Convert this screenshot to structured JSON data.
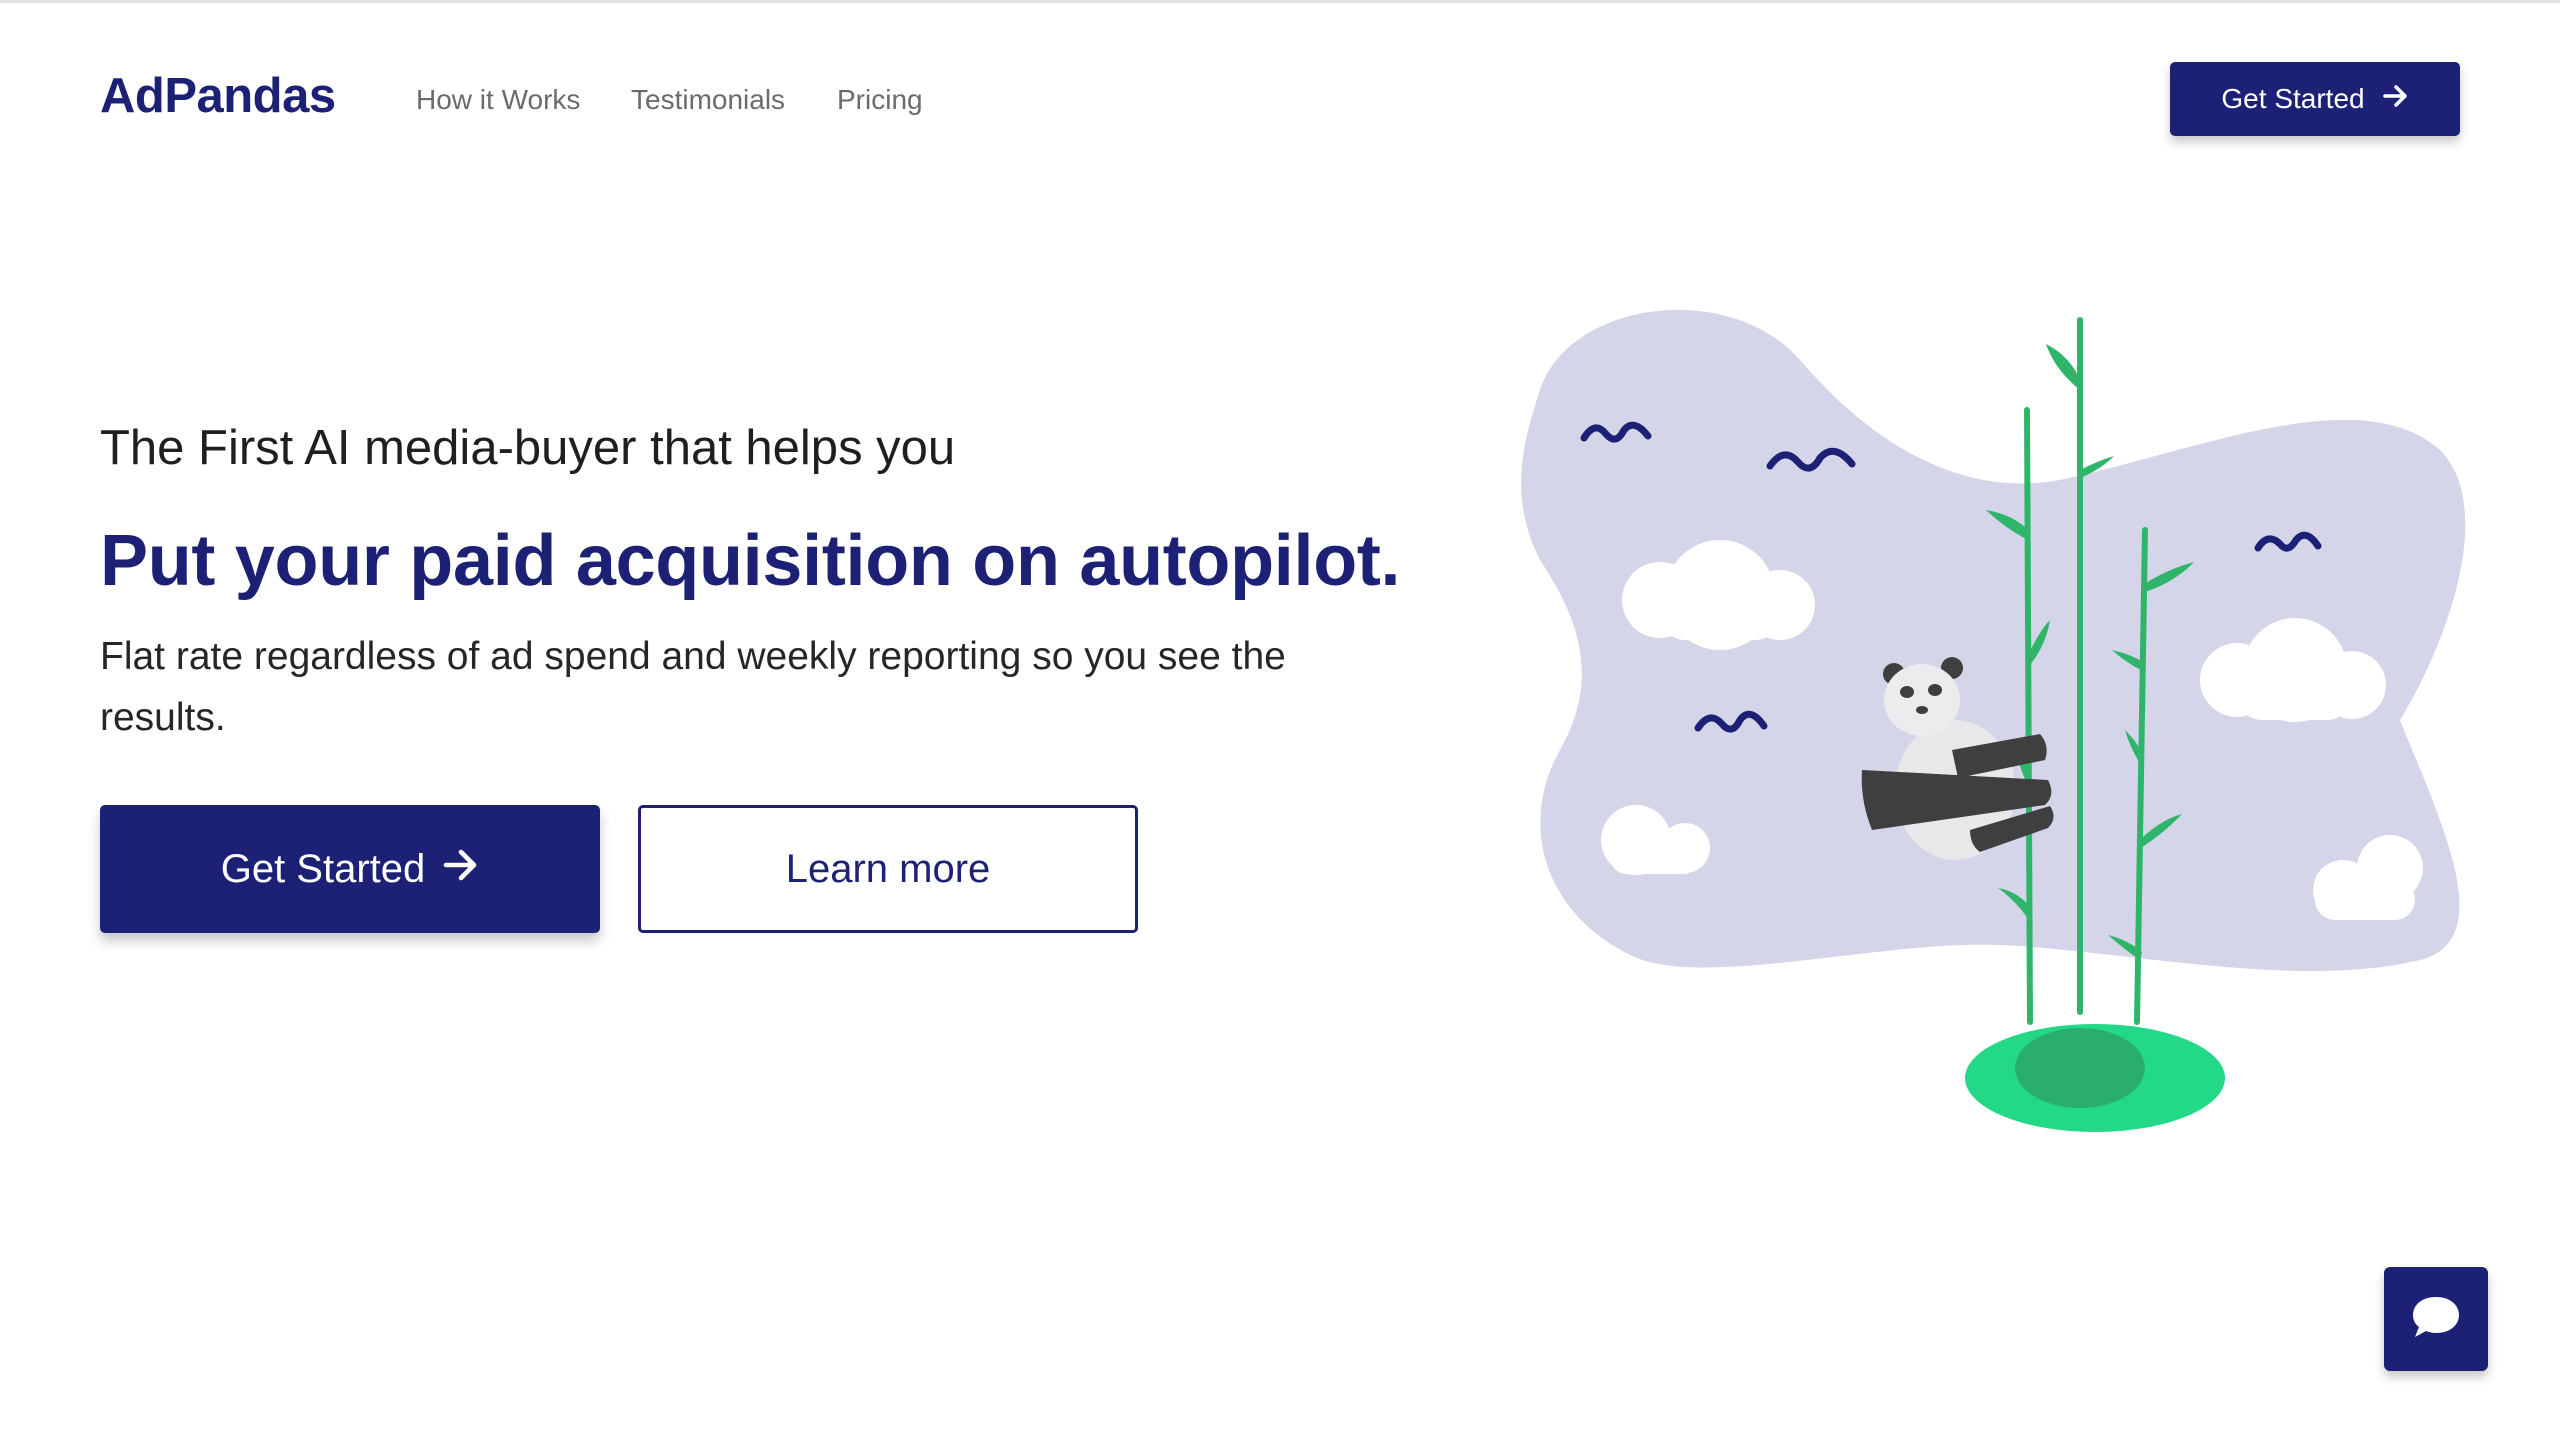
{
  "brand": {
    "name": "AdPandas",
    "primary_color": "#1c2175",
    "accent_green": "#2ecc71"
  },
  "nav": {
    "links": [
      {
        "label": "How it Works"
      },
      {
        "label": "Testimonials"
      },
      {
        "label": "Pricing"
      }
    ],
    "cta_label": "Get Started",
    "cta_icon": "arrow-right-icon"
  },
  "hero": {
    "eyebrow": "The First AI media-buyer that helps you",
    "headline": "Put your paid acquisition on autopilot.",
    "subheadline": "Flat rate regardless of ad spend and weekly reporting so you see the results.",
    "primary_cta": "Get Started",
    "primary_cta_icon": "arrow-right-icon",
    "secondary_cta": "Learn more"
  },
  "illustration": {
    "subject": "panda-on-bamboo-illustration",
    "blob_color": "#d4d5e8",
    "bird_color": "#1c2175",
    "bamboo_color": "#2fb56a",
    "grass_color": "#23d987",
    "grass_shadow_color": "#2aae6f"
  },
  "chat_widget": {
    "icon": "chat-bubble-icon"
  }
}
